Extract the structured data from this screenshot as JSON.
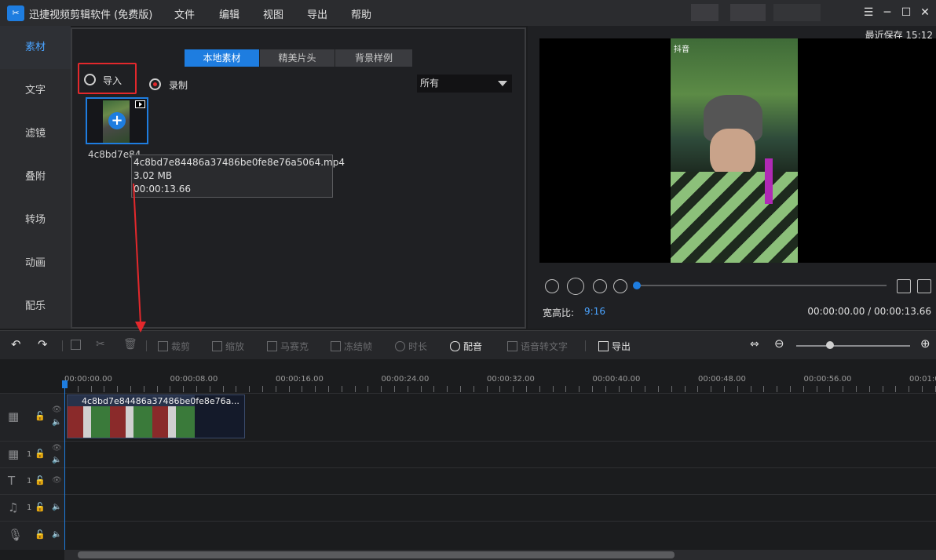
{
  "app": {
    "title": "迅捷视频剪辑软件 (免费版)",
    "logo_icon": "scissors-film-icon"
  },
  "menu": [
    "文件",
    "编辑",
    "视图",
    "导出",
    "帮助"
  ],
  "window_controls": [
    "menu-icon",
    "minimize-icon",
    "maximize-icon",
    "close-icon"
  ],
  "sidebar": {
    "items": [
      "素材",
      "文字",
      "滤镜",
      "叠附",
      "转场",
      "动画",
      "配乐"
    ],
    "active_index": 0
  },
  "media": {
    "tabs": [
      "本地素材",
      "精美片头",
      "背景样例"
    ],
    "active_tab": 0,
    "import_label": "导入",
    "record_label": "录制",
    "filter_value": "所有",
    "thumb_name": "4c8bd7e84",
    "tooltip": {
      "filename": "4c8bd7e84486a37486be0fe8e76a5064.mp4",
      "size": "3.02 MB",
      "duration": "00:00:13.66"
    }
  },
  "preview": {
    "last_saved": "最近保存 15:12",
    "aspect_label": "宽高比:",
    "aspect_value": "9:16",
    "time_readout": "00:00:00.00 / 00:00:13.66",
    "watermark": "抖音",
    "progress": 0
  },
  "toolbar": {
    "items": [
      {
        "label": "裁剪",
        "enabled": false
      },
      {
        "label": "缩放",
        "enabled": false
      },
      {
        "label": "马赛克",
        "enabled": false
      },
      {
        "label": "冻结帧",
        "enabled": false
      },
      {
        "label": "时长",
        "enabled": false
      },
      {
        "label": "配音",
        "enabled": true
      },
      {
        "label": "语音转文字",
        "enabled": false
      },
      {
        "label": "导出",
        "enabled": true
      }
    ]
  },
  "timeline": {
    "ruler": [
      "00:00:00.00",
      "00:00:08.00",
      "00:00:16.00",
      "00:00:24.00",
      "00:00:32.00",
      "00:00:40.00",
      "00:00:48.00",
      "00:00:56.00",
      "00:01:0"
    ],
    "clip_title": "4c8bd7e84486a37486be0fe8e76a...",
    "track_numbers": [
      "1",
      "1",
      "1"
    ]
  },
  "colors": {
    "accent": "#1e7de0",
    "highlight_red": "#e3282c",
    "bg": "#1b1c1e"
  }
}
